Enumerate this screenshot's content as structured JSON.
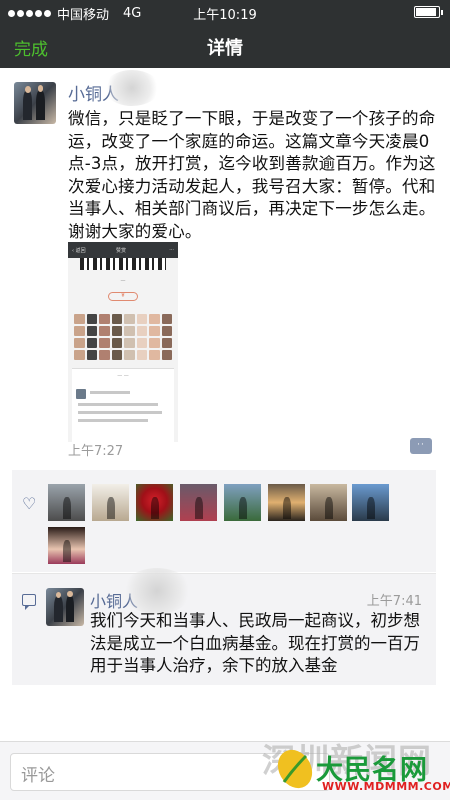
{
  "status_bar": {
    "carrier": "中国移动",
    "network": "4G",
    "time": "上午10:19",
    "battery_level": 0.92
  },
  "nav": {
    "done_label": "完成",
    "title": "详情"
  },
  "post": {
    "author": "小铜人",
    "text": "微信，只是眨了一下眼，于是改变了一个孩子的命运，改变了一个家庭的命运。这篇文章今天凌晨0点-3点，放开打赏，迄今收到善款逾百万。作为这次爱心接力活动发起人，我号召大家：暂停。代和当事人、相关部门商议后，再决定下一步怎么走。谢谢大家的爱心。",
    "time": "上午7:27",
    "comment_button": "··",
    "image_icon": "article-screenshot"
  },
  "likes": {
    "icon": "heart-icon",
    "count": 9
  },
  "comment": {
    "icon": "comment-icon",
    "author": "小铜人",
    "time": "上午7:41",
    "text": "我们今天和当事人、民政局一起商议，初步想法是成立一个白血病基金。现在打赏的一百万用于当事人治疗，余下的放入基金"
  },
  "input": {
    "placeholder": "评论"
  },
  "watermark": {
    "site_cn": "深圳新闻网",
    "brand": "大民名网",
    "url": "WWW.MDMMM.COM"
  },
  "colors": {
    "nav_bg": "#2e3132",
    "done_green": "#4dbf2e",
    "link_blue": "#576b95",
    "time_gray": "#9b9b9b"
  }
}
